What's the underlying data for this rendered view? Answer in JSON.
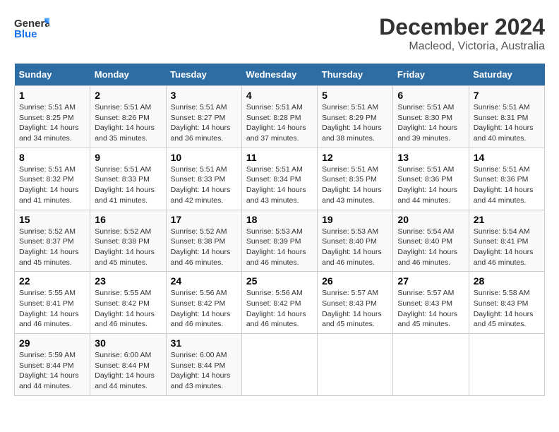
{
  "header": {
    "logo_general": "General",
    "logo_blue": "Blue",
    "title": "December 2024",
    "subtitle": "Macleod, Victoria, Australia"
  },
  "calendar": {
    "days_of_week": [
      "Sunday",
      "Monday",
      "Tuesday",
      "Wednesday",
      "Thursday",
      "Friday",
      "Saturday"
    ],
    "weeks": [
      [
        {
          "day": "",
          "empty": true
        },
        {
          "day": "",
          "empty": true
        },
        {
          "day": "",
          "empty": true
        },
        {
          "day": "",
          "empty": true
        },
        {
          "day": "5",
          "sunrise": "5:51 AM",
          "sunset": "8:29 PM",
          "daylight": "14 hours and 38 minutes."
        },
        {
          "day": "6",
          "sunrise": "5:51 AM",
          "sunset": "8:30 PM",
          "daylight": "14 hours and 39 minutes."
        },
        {
          "day": "7",
          "sunrise": "5:51 AM",
          "sunset": "8:31 PM",
          "daylight": "14 hours and 40 minutes."
        }
      ],
      [
        {
          "day": "1",
          "sunrise": "5:51 AM",
          "sunset": "8:25 PM",
          "daylight": "14 hours and 34 minutes."
        },
        {
          "day": "2",
          "sunrise": "5:51 AM",
          "sunset": "8:26 PM",
          "daylight": "14 hours and 35 minutes."
        },
        {
          "day": "3",
          "sunrise": "5:51 AM",
          "sunset": "8:27 PM",
          "daylight": "14 hours and 36 minutes."
        },
        {
          "day": "4",
          "sunrise": "5:51 AM",
          "sunset": "8:28 PM",
          "daylight": "14 hours and 37 minutes."
        },
        {
          "day": "5",
          "sunrise": "5:51 AM",
          "sunset": "8:29 PM",
          "daylight": "14 hours and 38 minutes."
        },
        {
          "day": "6",
          "sunrise": "5:51 AM",
          "sunset": "8:30 PM",
          "daylight": "14 hours and 39 minutes."
        },
        {
          "day": "7",
          "sunrise": "5:51 AM",
          "sunset": "8:31 PM",
          "daylight": "14 hours and 40 minutes."
        }
      ],
      [
        {
          "day": "8",
          "sunrise": "5:51 AM",
          "sunset": "8:32 PM",
          "daylight": "14 hours and 41 minutes."
        },
        {
          "day": "9",
          "sunrise": "5:51 AM",
          "sunset": "8:33 PM",
          "daylight": "14 hours and 41 minutes."
        },
        {
          "day": "10",
          "sunrise": "5:51 AM",
          "sunset": "8:33 PM",
          "daylight": "14 hours and 42 minutes."
        },
        {
          "day": "11",
          "sunrise": "5:51 AM",
          "sunset": "8:34 PM",
          "daylight": "14 hours and 43 minutes."
        },
        {
          "day": "12",
          "sunrise": "5:51 AM",
          "sunset": "8:35 PM",
          "daylight": "14 hours and 43 minutes."
        },
        {
          "day": "13",
          "sunrise": "5:51 AM",
          "sunset": "8:36 PM",
          "daylight": "14 hours and 44 minutes."
        },
        {
          "day": "14",
          "sunrise": "5:51 AM",
          "sunset": "8:36 PM",
          "daylight": "14 hours and 44 minutes."
        }
      ],
      [
        {
          "day": "15",
          "sunrise": "5:52 AM",
          "sunset": "8:37 PM",
          "daylight": "14 hours and 45 minutes."
        },
        {
          "day": "16",
          "sunrise": "5:52 AM",
          "sunset": "8:38 PM",
          "daylight": "14 hours and 45 minutes."
        },
        {
          "day": "17",
          "sunrise": "5:52 AM",
          "sunset": "8:38 PM",
          "daylight": "14 hours and 46 minutes."
        },
        {
          "day": "18",
          "sunrise": "5:53 AM",
          "sunset": "8:39 PM",
          "daylight": "14 hours and 46 minutes."
        },
        {
          "day": "19",
          "sunrise": "5:53 AM",
          "sunset": "8:40 PM",
          "daylight": "14 hours and 46 minutes."
        },
        {
          "day": "20",
          "sunrise": "5:54 AM",
          "sunset": "8:40 PM",
          "daylight": "14 hours and 46 minutes."
        },
        {
          "day": "21",
          "sunrise": "5:54 AM",
          "sunset": "8:41 PM",
          "daylight": "14 hours and 46 minutes."
        }
      ],
      [
        {
          "day": "22",
          "sunrise": "5:55 AM",
          "sunset": "8:41 PM",
          "daylight": "14 hours and 46 minutes."
        },
        {
          "day": "23",
          "sunrise": "5:55 AM",
          "sunset": "8:42 PM",
          "daylight": "14 hours and 46 minutes."
        },
        {
          "day": "24",
          "sunrise": "5:56 AM",
          "sunset": "8:42 PM",
          "daylight": "14 hours and 46 minutes."
        },
        {
          "day": "25",
          "sunrise": "5:56 AM",
          "sunset": "8:42 PM",
          "daylight": "14 hours and 46 minutes."
        },
        {
          "day": "26",
          "sunrise": "5:57 AM",
          "sunset": "8:43 PM",
          "daylight": "14 hours and 45 minutes."
        },
        {
          "day": "27",
          "sunrise": "5:57 AM",
          "sunset": "8:43 PM",
          "daylight": "14 hours and 45 minutes."
        },
        {
          "day": "28",
          "sunrise": "5:58 AM",
          "sunset": "8:43 PM",
          "daylight": "14 hours and 45 minutes."
        }
      ],
      [
        {
          "day": "29",
          "sunrise": "5:59 AM",
          "sunset": "8:44 PM",
          "daylight": "14 hours and 44 minutes."
        },
        {
          "day": "30",
          "sunrise": "6:00 AM",
          "sunset": "8:44 PM",
          "daylight": "14 hours and 44 minutes."
        },
        {
          "day": "31",
          "sunrise": "6:00 AM",
          "sunset": "8:44 PM",
          "daylight": "14 hours and 43 minutes."
        },
        {
          "day": "",
          "empty": true
        },
        {
          "day": "",
          "empty": true
        },
        {
          "day": "",
          "empty": true
        },
        {
          "day": "",
          "empty": true
        }
      ]
    ]
  }
}
